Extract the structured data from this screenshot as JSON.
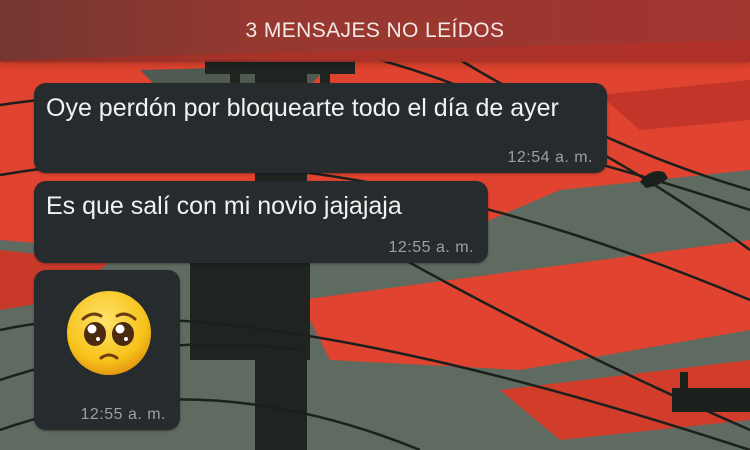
{
  "chat": {
    "unread_banner": "3 MENSAJES NO LEÍDOS",
    "messages": [
      {
        "text": "Oye perdón por bloquearte todo el día de ayer",
        "time": "12:54 a. m."
      },
      {
        "text": "Es que salí con mi novio jajajaja",
        "time": "12:55 a. m."
      },
      {
        "emoji": "pleading-face-emoji",
        "time": "12:55 a. m."
      }
    ]
  },
  "colors": {
    "bubble": "#262c2e",
    "banner": "#a5302a",
    "wallpaper_red": "#e0432f",
    "wallpaper_gray": "#5f6a60"
  }
}
